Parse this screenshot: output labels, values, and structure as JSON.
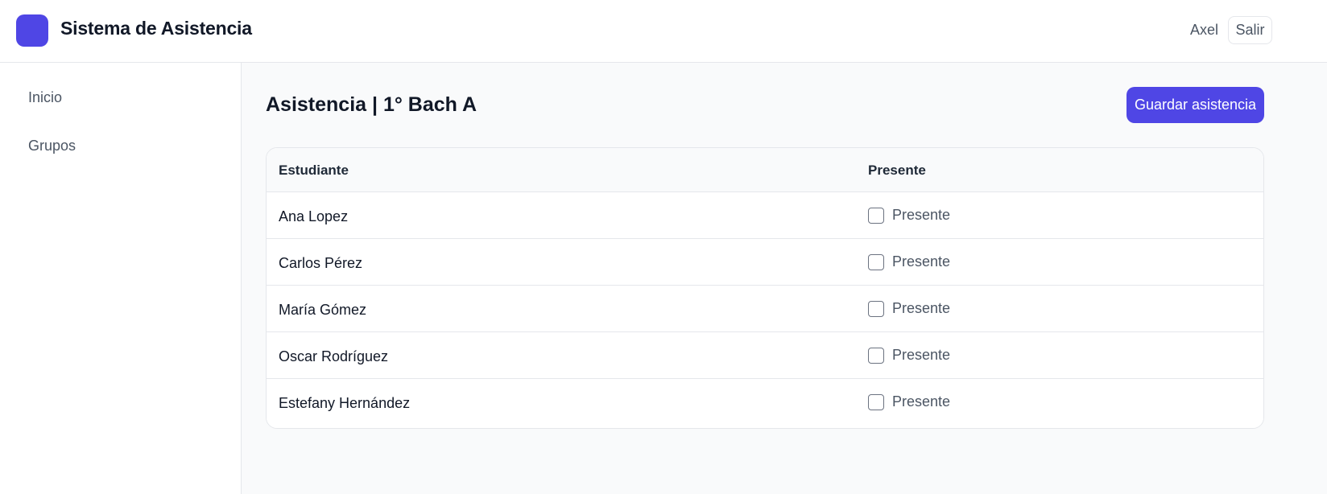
{
  "app": {
    "title": "Sistema de Asistencia",
    "brand_color": "#4f46e5"
  },
  "header": {
    "user_name": "Axel",
    "logout_label": "Salir"
  },
  "sidebar": {
    "items": [
      {
        "label": "Inicio"
      },
      {
        "label": "Grupos"
      }
    ]
  },
  "main": {
    "title": "Asistencia | 1° Bach A",
    "save_label": "Guardar asistencia",
    "table": {
      "columns": [
        "Estudiante",
        "Presente"
      ],
      "rows": [
        {
          "name": "Ana Lopez",
          "check_label": "Presente",
          "checked": false
        },
        {
          "name": "Carlos Pérez",
          "check_label": "Presente",
          "checked": false
        },
        {
          "name": "María Gómez",
          "check_label": "Presente",
          "checked": false
        },
        {
          "name": "Oscar Rodríguez",
          "check_label": "Presente",
          "checked": false
        },
        {
          "name": "Estefany Hernández",
          "check_label": "Presente",
          "checked": false
        }
      ]
    }
  }
}
